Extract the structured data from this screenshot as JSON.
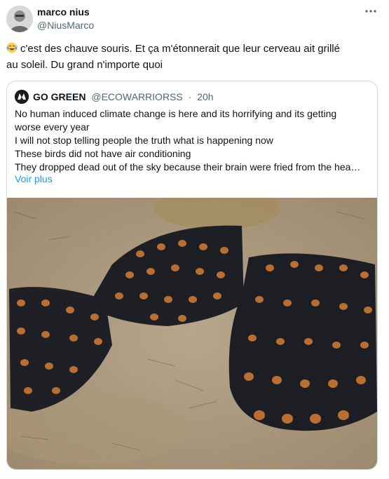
{
  "author": {
    "name": "marco nius",
    "handle": "@NiusMarco"
  },
  "menu_icon": "more-dots-icon",
  "tweet": {
    "emoji": "face-with-tears-of-joy-icon",
    "lines": [
      "c'est des chauve souris. Et ça m'étonnerait que leur cerveau ait grillé",
      "au soleil. Du grand n'importe quoi"
    ]
  },
  "quoted": {
    "name": "GO GREEN",
    "handle": "@ECOWARRIORSS",
    "separator": "·",
    "time": "20h",
    "lines": [
      "No human induced climate change is here and its horrifying and its getting",
      "worse every year",
      "I will not stop telling people the truth what is happening now",
      "These birds did not have air conditioning",
      "They dropped dead out of the sky because their brain were fried from the hea…"
    ],
    "see_more": "Voir plus",
    "image_icon": "photo-of-dead-bats-on-grass"
  },
  "colors": {
    "text": "#0f1419",
    "muted": "#536471",
    "link": "#1d9bf0",
    "border": "#cfd9de"
  }
}
